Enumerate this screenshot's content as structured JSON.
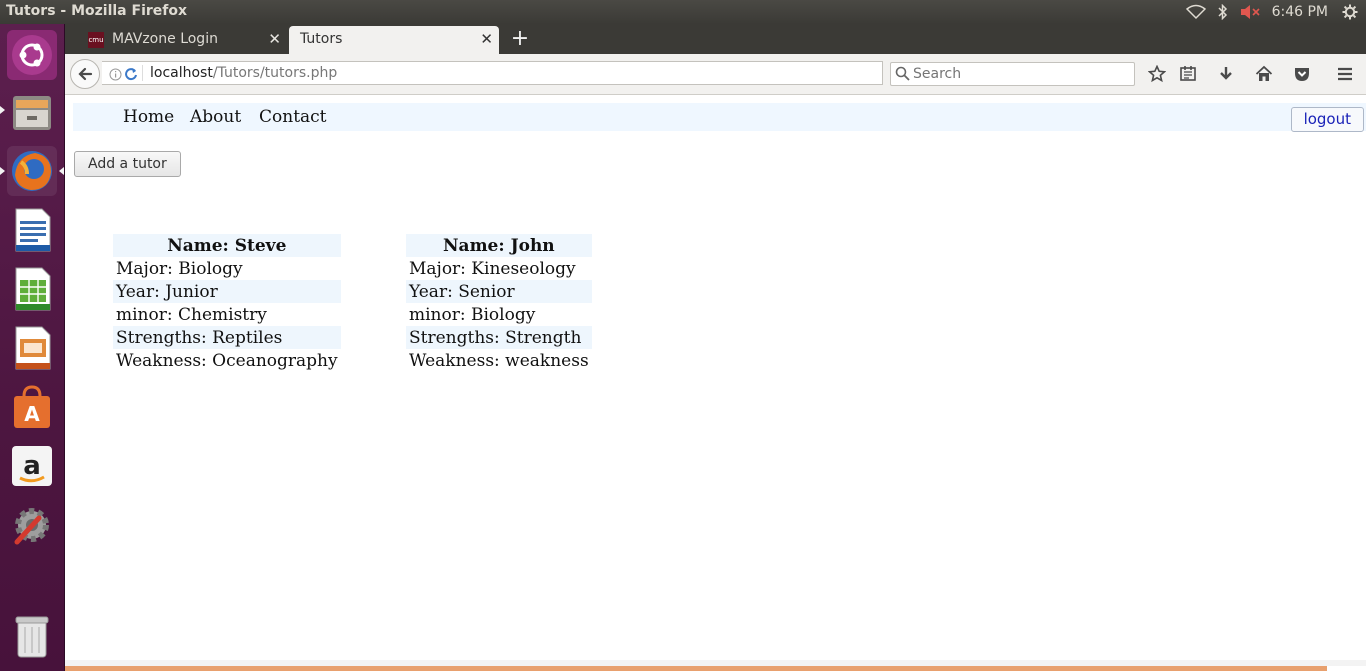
{
  "window": {
    "title": "Tutors - Mozilla Firefox"
  },
  "system_tray": {
    "clock": "6:46 PM",
    "icons": [
      "wifi-icon",
      "bluetooth-icon",
      "volume-muted-icon",
      "settings-gear-icon"
    ]
  },
  "launcher": {
    "items": [
      "ubuntu-dash",
      "files",
      "firefox",
      "libreoffice-writer",
      "libreoffice-calc",
      "libreoffice-impress",
      "ubuntu-software",
      "amazon",
      "system-settings",
      "trash"
    ]
  },
  "browser": {
    "tabs": [
      {
        "label": "MAVzone Login",
        "favicon": "cmu"
      },
      {
        "label": "Tutors"
      }
    ],
    "url_host": "localhost",
    "url_path": "/Tutors/tutors.php",
    "search_placeholder": "Search"
  },
  "site": {
    "nav": [
      "Home",
      "About",
      "Contact"
    ],
    "logout_label": "logout",
    "add_tutor_label": "Add a tutor"
  },
  "tutors": [
    {
      "name": "Name: Steve",
      "major": "Major: Biology",
      "year": "Year: Junior",
      "minor": "minor: Chemistry",
      "strengths": "Strengths: Reptiles",
      "weakness": "Weakness: Oceanography"
    },
    {
      "name": "Name: John",
      "major": "Major: Kineseology",
      "year": "Year: Senior",
      "minor": "minor: Biology",
      "strengths": "Strengths: Strength",
      "weakness": "Weakness: weakness"
    }
  ]
}
